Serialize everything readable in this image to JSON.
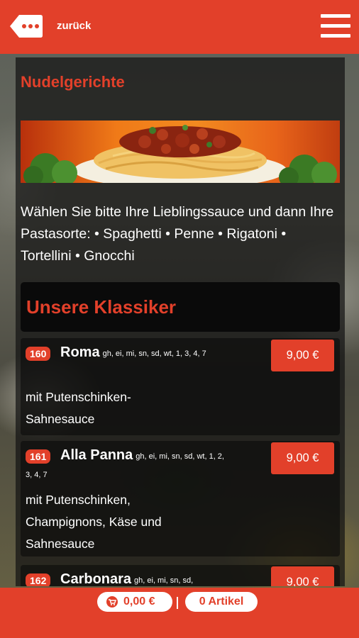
{
  "header": {
    "back_label": "zurück",
    "back_icon": "dots-tag-back-icon",
    "menu_icon": "hamburger-menu-icon",
    "background_color": "#e2402a"
  },
  "category": {
    "title": "Nudelgerichte",
    "intro": "Wählen Sie bitte Ihre Lieblingssauce und dann Ihre Pastasorte: • Spaghetti • Penne • Rigatoni • Tortellini • Gnocchi"
  },
  "section": {
    "title": "Unsere Klassiker"
  },
  "items": [
    {
      "number": "160",
      "name": "Roma",
      "allergens": "gh, ei, mi, sn, sd, wt, 1, 3, 4, 7",
      "price": "9,00 €",
      "description": "mit Putenschinken-Sahnesauce"
    },
    {
      "number": "161",
      "name": "Alla Panna",
      "allergens": "gh, ei, mi, sn, sd, wt, 1, 2, 3, 4, 7",
      "price": "9,00 €",
      "description": "mit Putenschinken, Champignons, Käse und Sahnesauce"
    },
    {
      "number": "162",
      "name": "Carbonara",
      "allergens": "gh, ei, mi, sn, sd,",
      "price": "9,00 €",
      "description": ""
    }
  ],
  "footer": {
    "cart_icon": "shopping-cart-icon",
    "cart_total": "0,00 €",
    "articles_count": "0 Artikel"
  },
  "colors": {
    "accent": "#e2402a",
    "panel": "#141414",
    "text": "#ffffff"
  }
}
